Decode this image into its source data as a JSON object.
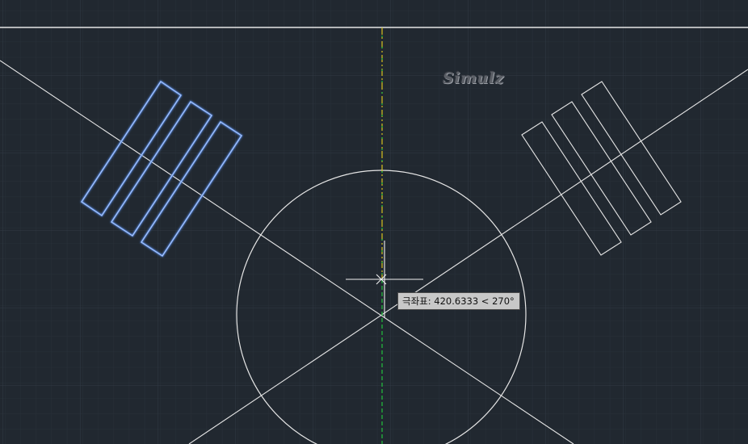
{
  "viewport": {
    "background_color": "#212830",
    "grid_minor_color": "#283039",
    "grid_major_color": "#313a45",
    "line_color": "#e6e6e6",
    "selected_color": "#5b8ee8",
    "polar_track_color": "#d8c21e",
    "polar_alt_color": "#22c13e"
  },
  "watermark": {
    "text": "Simulz"
  },
  "polar_tooltip": {
    "label": "극좌표",
    "distance": "420.6333",
    "angle": "270°",
    "text": "극좌표: 420.6333 < 270°"
  },
  "crosshair": {
    "icon": "crosshair-cursor-icon"
  },
  "objects": [
    {
      "name": "top-horizontal-line",
      "type": "line"
    },
    {
      "name": "center-vertical-axis",
      "type": "polar-tracking-line"
    },
    {
      "name": "diagonal-line-left",
      "type": "line"
    },
    {
      "name": "diagonal-line-right",
      "type": "line"
    },
    {
      "name": "center-circle",
      "type": "circle"
    },
    {
      "name": "left-rectangles-group",
      "type": "rectangles",
      "count": 3,
      "selected": true
    },
    {
      "name": "right-rectangles-group",
      "type": "rectangles",
      "count": 3,
      "selected": false
    }
  ]
}
